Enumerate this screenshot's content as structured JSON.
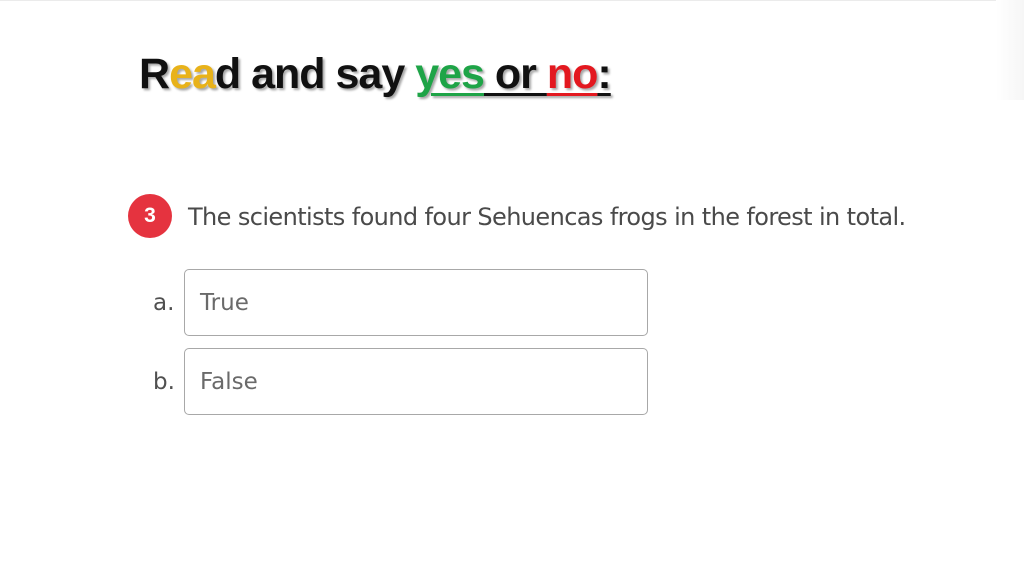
{
  "title": {
    "part_r": "R",
    "part_ea": "ea",
    "part_d_and_say": "d and say ",
    "part_yes": "yes",
    "part_space_or_space": " or ",
    "part_no": "no",
    "part_colon": ":"
  },
  "question": {
    "number": "3",
    "text": "The scientists found four Sehuencas frogs in the forest in total."
  },
  "options": [
    {
      "letter": "a.",
      "label": "True"
    },
    {
      "letter": "b.",
      "label": "False"
    }
  ],
  "colors": {
    "highlight_ea": "#e8b21a",
    "yes": "#1ea447",
    "no": "#e3181f",
    "badge": "#e5333f"
  }
}
